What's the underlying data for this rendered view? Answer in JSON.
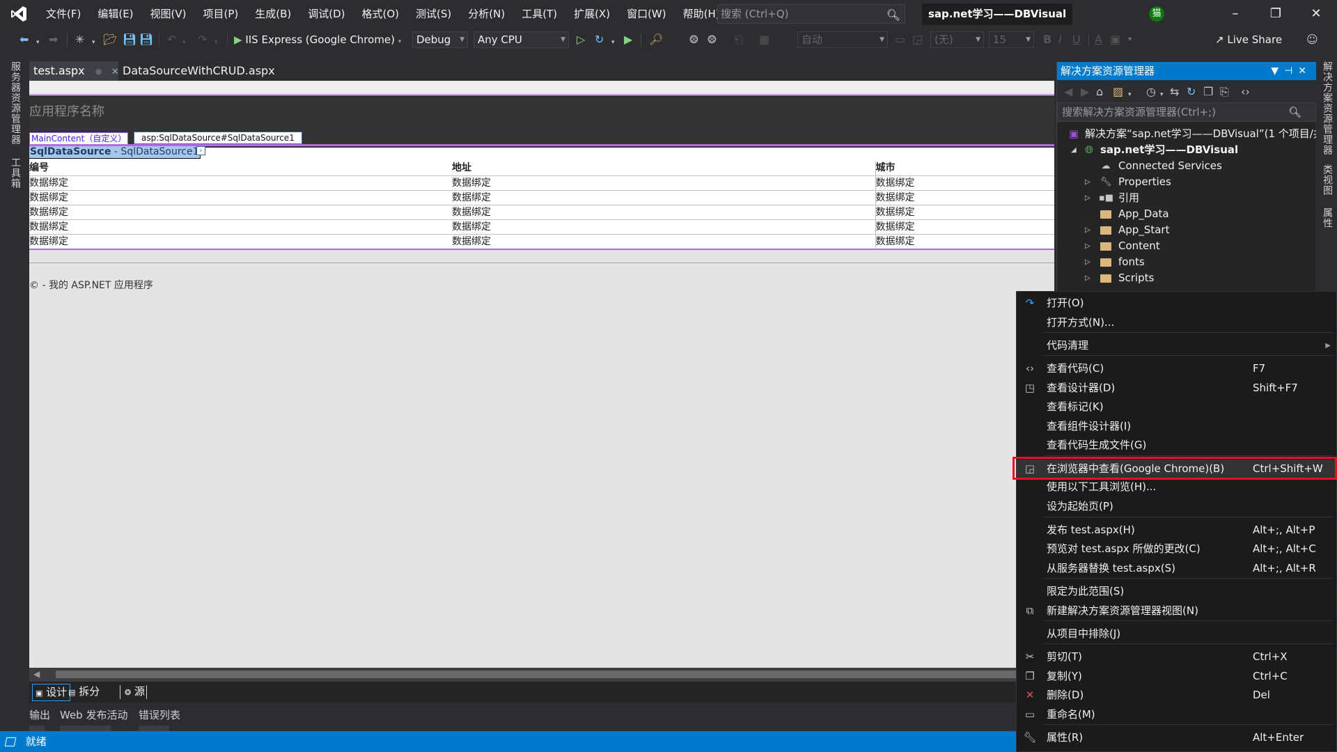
{
  "menu": {
    "items": [
      "文件(F)",
      "编辑(E)",
      "视图(V)",
      "项目(P)",
      "生成(B)",
      "调试(D)",
      "格式(O)",
      "测试(S)",
      "分析(N)",
      "工具(T)",
      "扩展(X)",
      "窗口(W)",
      "帮助(H)"
    ],
    "search_placeholder": "搜索 (Ctrl+Q)",
    "solution_title": "sap.net学习——DBVisual",
    "user_initial": "猫"
  },
  "toolbar": {
    "run_target": "IIS Express (Google Chrome)",
    "configuration": "Debug",
    "platform": "Any CPU",
    "block_format": "自动",
    "font_name": "(无)",
    "font_size": "15",
    "bold": "B",
    "italic": "I",
    "underline": "U",
    "live_share": "Live Share"
  },
  "left_rail": {
    "tabs": [
      "服务器资源管理器",
      "工具箱"
    ]
  },
  "right_rail": {
    "tabs": [
      "解决方案资源管理器",
      "类视图",
      "属性"
    ]
  },
  "doc_tabs": [
    {
      "label": "test.aspx",
      "active": true
    },
    {
      "label": "DataSourceWithCRUD.aspx",
      "active": false
    }
  ],
  "design": {
    "app_name": "应用程序名称",
    "maincontent_tag": "MainContent（自定义）",
    "sqlds_tag": "asp:SqlDataSource#SqlDataSource1",
    "sqlds_control_bold": "SqlDataSource",
    "sqlds_control_rest": " - SqlDataSource1",
    "grid": {
      "columns": [
        "编号",
        "地址",
        "城市"
      ],
      "rows": [
        [
          "数据绑定",
          "数据绑定",
          "数据绑定"
        ],
        [
          "数据绑定",
          "数据绑定",
          "数据绑定"
        ],
        [
          "数据绑定",
          "数据绑定",
          "数据绑定"
        ],
        [
          "数据绑定",
          "数据绑定",
          "数据绑定"
        ],
        [
          "数据绑定",
          "数据绑定",
          "数据绑定"
        ]
      ]
    },
    "footer": "© - 我的 ASP.NET 应用程序"
  },
  "view_switcher": {
    "design": "设计",
    "split": "拆分",
    "source": "源"
  },
  "bottom_tabs": [
    "输出",
    "Web 发布活动",
    "错误列表"
  ],
  "status": {
    "text": "就绪"
  },
  "solution_explorer": {
    "title": "解决方案资源管理器",
    "search_placeholder": "搜索解决方案资源管理器(Ctrl+;)",
    "solution_node": "解决方案“sap.net学习——DBVisual”(1 个项目/共",
    "project_node": "sap.net学习——DBVisual",
    "items": [
      {
        "label": "Connected Services",
        "expandable": false,
        "icon": "cloud"
      },
      {
        "label": "Properties",
        "expandable": true,
        "icon": "wrench"
      },
      {
        "label": "引用",
        "expandable": true,
        "icon": "reference"
      },
      {
        "label": "App_Data",
        "expandable": false,
        "icon": "folder"
      },
      {
        "label": "App_Start",
        "expandable": true,
        "icon": "folder"
      },
      {
        "label": "Content",
        "expandable": true,
        "icon": "folder"
      },
      {
        "label": "fonts",
        "expandable": true,
        "icon": "folder"
      },
      {
        "label": "Scripts",
        "expandable": true,
        "icon": "folder"
      }
    ]
  },
  "context_menu": {
    "items": [
      {
        "label": "打开(O)",
        "shortcut": "",
        "icon": "open-arrow"
      },
      {
        "label": "打开方式(N)...",
        "shortcut": "",
        "icon": ""
      },
      {
        "label": "代码清理",
        "shortcut": "",
        "icon": "",
        "submenu": true
      },
      {
        "label": "查看代码(C)",
        "shortcut": "F7",
        "icon": "code"
      },
      {
        "label": "查看设计器(D)",
        "shortcut": "Shift+F7",
        "icon": "designer"
      },
      {
        "label": "查看标记(K)",
        "shortcut": "",
        "icon": ""
      },
      {
        "label": "查看组件设计器(I)",
        "shortcut": "",
        "icon": ""
      },
      {
        "label": "查看代码生成文件(G)",
        "shortcut": "",
        "icon": ""
      },
      {
        "label": "在浏览器中查看(Google Chrome)(B)",
        "shortcut": "Ctrl+Shift+W",
        "icon": "browser",
        "highlighted": true
      },
      {
        "label": "使用以下工具浏览(H)...",
        "shortcut": "",
        "icon": ""
      },
      {
        "label": "设为起始页(P)",
        "shortcut": "",
        "icon": ""
      },
      {
        "label": "发布 test.aspx(H)",
        "shortcut": "Alt+;, Alt+P",
        "icon": ""
      },
      {
        "label": "预览对 test.aspx 所做的更改(C)",
        "shortcut": "Alt+;, Alt+C",
        "icon": ""
      },
      {
        "label": "从服务器替换 test.aspx(S)",
        "shortcut": "Alt+;, Alt+R",
        "icon": ""
      },
      {
        "label": "限定为此范围(S)",
        "shortcut": "",
        "icon": ""
      },
      {
        "label": "新建解决方案资源管理器视图(N)",
        "shortcut": "",
        "icon": "new-view"
      },
      {
        "label": "从项目中排除(J)",
        "shortcut": "",
        "icon": ""
      },
      {
        "label": "剪切(T)",
        "shortcut": "Ctrl+X",
        "icon": "scissors"
      },
      {
        "label": "复制(Y)",
        "shortcut": "Ctrl+C",
        "icon": "copy"
      },
      {
        "label": "删除(D)",
        "shortcut": "Del",
        "icon": "delete"
      },
      {
        "label": "重命名(M)",
        "shortcut": "",
        "icon": "rename"
      },
      {
        "label": "属性(R)",
        "shortcut": "Alt+Enter",
        "icon": "wrench"
      }
    ]
  },
  "colors": {
    "accent": "#007acc",
    "highlight_box": "#e81123",
    "designer_border": "#b36ae2"
  }
}
